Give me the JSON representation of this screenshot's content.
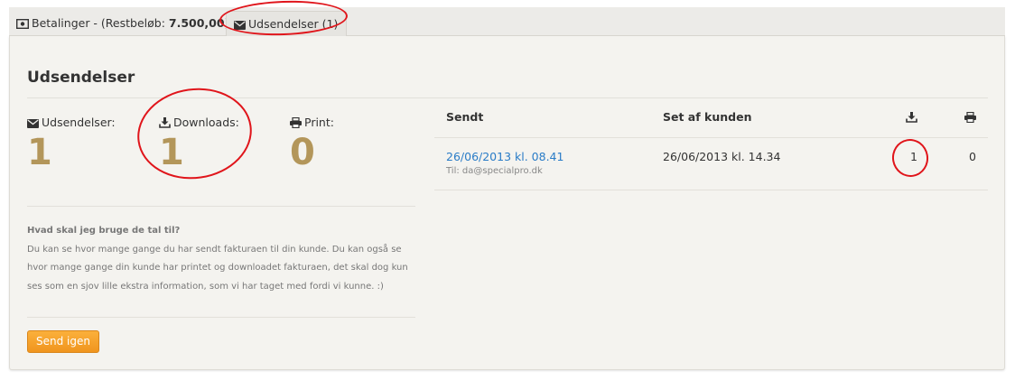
{
  "tabs": [
    {
      "prefix": "Betalinger - (Restbeløb: ",
      "amount": "7.500,00",
      "suffix": ")"
    },
    {
      "label": "Udsendelser (1)"
    }
  ],
  "panel": {
    "title": "Udsendelser",
    "stats": [
      {
        "label": "Udsendelser:",
        "value": "1",
        "icon": "envelope-icon"
      },
      {
        "label": "Downloads:",
        "value": "1",
        "icon": "download-icon"
      },
      {
        "label": "Print:",
        "value": "0",
        "icon": "print-icon"
      }
    ],
    "help": {
      "title": "Hvad skal jeg bruge de tal til?",
      "text": "Du kan se hvor mange gange du har sendt fakturaen til din kunde. Du kan også se hvor mange gange din kunde har printet og downloadet fakturaen, det skal dog kun ses som en sjov lille ekstra information, som vi har taget med fordi vi kunne. :)"
    },
    "resend_button": "Send igen",
    "table": {
      "headers": {
        "sent": "Sendt",
        "seen": "Set af kunden",
        "downloads_icon": "download-icon",
        "print_icon": "print-icon"
      },
      "rows": [
        {
          "sent": "26/06/2013 kl. 08.41",
          "to": "Til: da@specialpro.dk",
          "seen": "26/06/2013 kl. 14.34",
          "downloads": "1",
          "prints": "0"
        }
      ]
    }
  },
  "colors": {
    "stat_value": "#b3965a",
    "link": "#2a7cc7",
    "button": "#f7a12a",
    "annotation": "#e0151b"
  }
}
